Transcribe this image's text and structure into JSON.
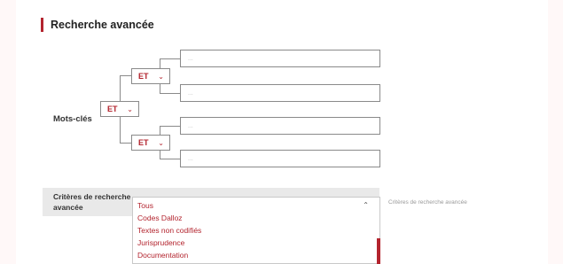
{
  "header": {
    "title": "Recherche avancée"
  },
  "keywords": {
    "label": "Mots-clés",
    "root_operator": "ET",
    "top_operator": "ET",
    "bottom_operator": "ET",
    "input_placeholder": "..."
  },
  "criteria": {
    "label": "Critères de recherche avancée",
    "side_hint": "Critères de recherche avancée",
    "options": [
      "Tous",
      "Codes Dalloz",
      "Textes non codifiés",
      "Jurisprudence",
      "Documentation"
    ]
  },
  "colors": {
    "accent": "#b3242e",
    "border": "#8a8a8a",
    "criteria_bg": "#e9e9e9"
  }
}
